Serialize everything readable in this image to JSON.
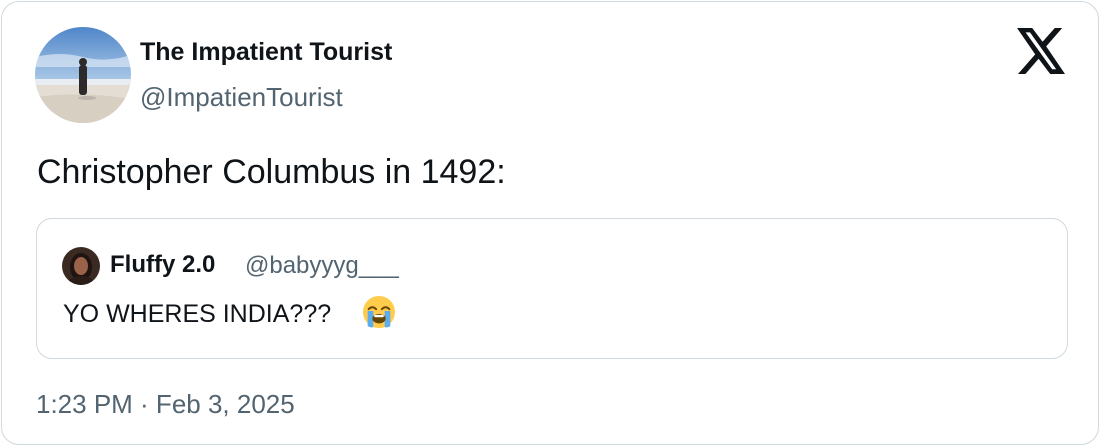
{
  "tweet": {
    "author": {
      "name": "The Impatient Tourist",
      "handle": "@ImpatienTourist"
    },
    "text": "Christopher Columbus in 1492:",
    "quoted": {
      "name": "Fluffy 2.0",
      "handle": "@babyyyg___",
      "text": "YO WHERES INDIA???",
      "emoji": "loudly-crying-face"
    },
    "timestamp": "1:23 PM · Feb 3, 2025"
  },
  "icons": {
    "logo": "x-logo-icon"
  },
  "colors": {
    "text_primary": "#0f1419",
    "text_secondary": "#536471",
    "border": "#cfd9de"
  }
}
